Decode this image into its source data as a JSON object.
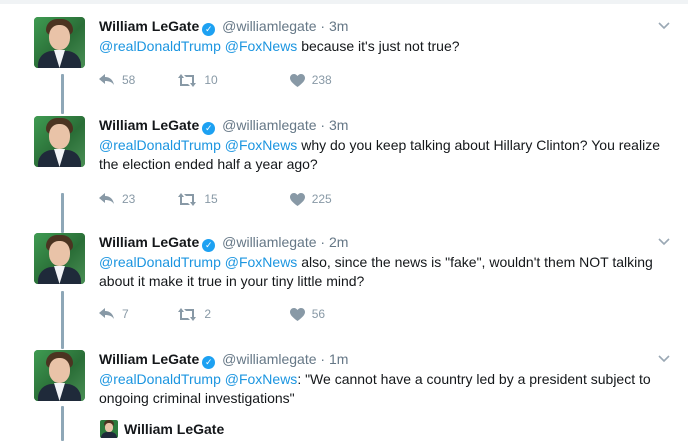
{
  "tweets": [
    {
      "name": "William LeGate",
      "handle": "@williamlegate",
      "time": "3m",
      "mentions": [
        "@realDonaldTrump",
        "@FoxNews"
      ],
      "text_rest": " because it's just not true?",
      "replies": "58",
      "retweets": "10",
      "likes": "238"
    },
    {
      "name": "William LeGate",
      "handle": "@williamlegate",
      "time": "3m",
      "mentions": [
        "@realDonaldTrump",
        "@FoxNews"
      ],
      "text_rest": " why do you keep talking about Hillary Clinton? You realize the election ended half a year ago?",
      "replies": "23",
      "retweets": "15",
      "likes": "225"
    },
    {
      "name": "William LeGate",
      "handle": "@williamlegate",
      "time": "2m",
      "mentions": [
        "@realDonaldTrump",
        "@FoxNews"
      ],
      "text_rest": " also, since the news is \"fake\", wouldn't them NOT talking about it make it true in your tiny little mind?",
      "replies": "7",
      "retweets": "2",
      "likes": "56"
    },
    {
      "name": "William LeGate",
      "handle": "@williamlegate",
      "time": "1m",
      "mentions": [
        "@realDonaldTrump",
        "@FoxNews"
      ],
      "text_rest": ": \"We cannot have a country led by a president subject to ongoing criminal investigations\""
    }
  ],
  "quoted": {
    "name": "William LeGate"
  },
  "separator": "·",
  "icons": {
    "reply": "reply-icon",
    "retweet": "retweet-icon",
    "like": "heart-icon",
    "verified": "verified-icon",
    "caret": "chevron-down-icon"
  },
  "colors": {
    "link": "#1b95e0",
    "action": "#8899a6",
    "thread": "#8ea7b7",
    "verified": "#1da1f2"
  }
}
